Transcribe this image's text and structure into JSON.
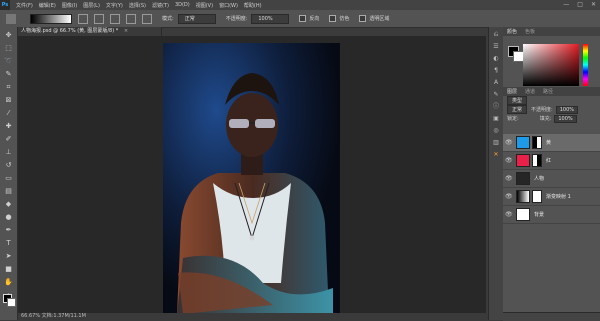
{
  "app": {
    "logo": "Ps"
  },
  "menu": [
    "文件(F)",
    "编辑(E)",
    "图像(I)",
    "图层(L)",
    "文字(Y)",
    "选择(S)",
    "滤镜(T)",
    "3D(D)",
    "视图(V)",
    "窗口(W)",
    "帮助(H)"
  ],
  "window_controls": {
    "minimize": "—",
    "maximize": "□",
    "close": "✕"
  },
  "options": {
    "mode_label": "模式:",
    "mode_value": "正常",
    "opacity_label": "不透明度:",
    "opacity_value": "100%",
    "reverse_label": "反向",
    "dither_label": "仿色",
    "transparency_label": "透明区域"
  },
  "document": {
    "tab_title": "人物海报.psd @ 66.7% (黄, 图层蒙版/8) *",
    "close_glyph": "×",
    "status": "66.67%   文档:1.37M/11.1M"
  },
  "panels": {
    "color_tabs": [
      "颜色",
      "色板"
    ],
    "layer_tabs": [
      "图层",
      "通道",
      "路径"
    ],
    "kind_label": "类型",
    "blend_mode": "正常",
    "opacity_label": "不透明度:",
    "opacity_value": "100%",
    "lock_label": "锁定:",
    "fill_label": "填充:",
    "fill_value": "100%"
  },
  "layers": [
    {
      "name": "黄",
      "thumb_color": "#1e9be8",
      "selected": true
    },
    {
      "name": "红",
      "thumb_color": "#e8204a",
      "selected": false
    },
    {
      "name": "人物",
      "thumb_color": "#262626",
      "selected": false
    },
    {
      "name": "渐变映射 1",
      "thumb_color": "#7a7a7a",
      "selected": false
    },
    {
      "name": "背景",
      "thumb_color": "#ffffff",
      "selected": false
    }
  ],
  "tools": [
    "move-tool",
    "marquee-tool",
    "lasso-tool",
    "quick-select-tool",
    "crop-tool",
    "frame-tool",
    "eyedropper-tool",
    "healing-tool",
    "brush-tool",
    "stamp-tool",
    "history-brush-tool",
    "eraser-tool",
    "gradient-tool",
    "blur-tool",
    "dodge-tool",
    "pen-tool",
    "type-tool",
    "path-select-tool",
    "shape-tool",
    "hand-tool",
    "zoom-tool"
  ],
  "colors": {
    "accent": "#31a8ff",
    "panel_bg": "#535353",
    "canvas_bg": "#282828",
    "selected_layer": "#6a6a6a"
  }
}
